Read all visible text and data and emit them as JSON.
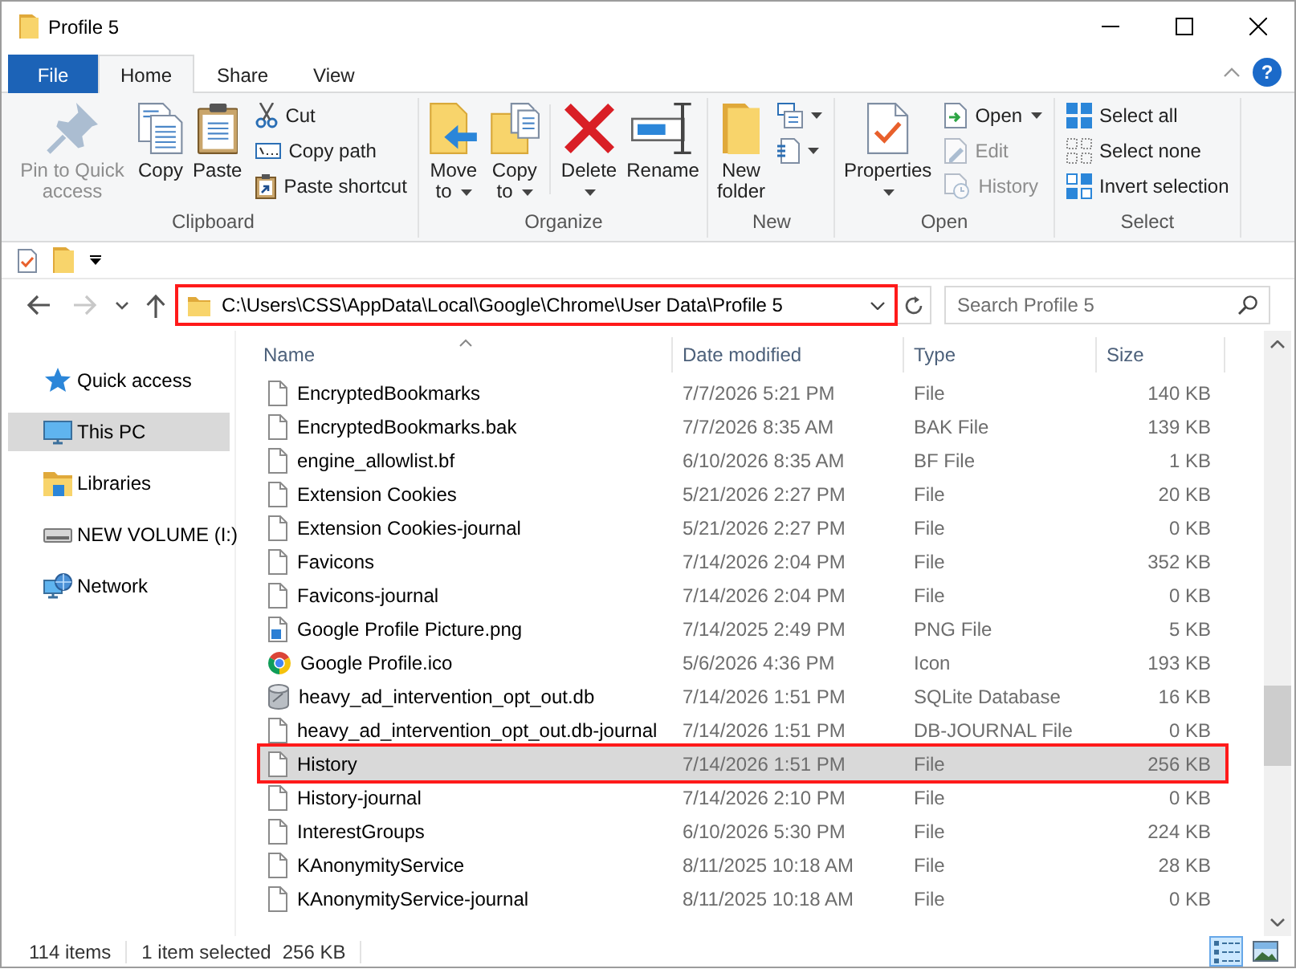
{
  "window": {
    "title": "Profile 5"
  },
  "ribbon_tabs": [
    {
      "label": "File",
      "kind": "file",
      "selected": false
    },
    {
      "label": "Home",
      "kind": "tab",
      "selected": true
    },
    {
      "label": "Share",
      "kind": "tab",
      "selected": false
    },
    {
      "label": "View",
      "kind": "tab",
      "selected": false
    }
  ],
  "help": "?",
  "ribbon": {
    "groups": [
      {
        "label": "Clipboard",
        "commands": [
          {
            "label": "Pin to Quick access",
            "kind": "large",
            "disabled": true,
            "dropdown": false
          },
          {
            "label": "Copy",
            "kind": "large",
            "disabled": false,
            "dropdown": false
          },
          {
            "label": "Paste",
            "kind": "large",
            "disabled": false,
            "dropdown": false
          },
          {
            "label": "Cut",
            "kind": "small",
            "disabled": false,
            "dropdown": false
          },
          {
            "label": "Copy path",
            "kind": "small",
            "disabled": false,
            "dropdown": false
          },
          {
            "label": "Paste shortcut",
            "kind": "small",
            "disabled": false,
            "dropdown": false
          }
        ]
      },
      {
        "label": "Organize",
        "commands": [
          {
            "label": "Move to",
            "kind": "large",
            "disabled": false,
            "dropdown": true
          },
          {
            "label": "Copy to",
            "kind": "large",
            "disabled": false,
            "dropdown": true
          },
          {
            "label": "Delete",
            "kind": "large",
            "disabled": false,
            "dropdown": true
          },
          {
            "label": "Rename",
            "kind": "large",
            "disabled": false,
            "dropdown": false
          }
        ]
      },
      {
        "label": "New",
        "commands": [
          {
            "label": "New folder",
            "kind": "large",
            "disabled": false,
            "dropdown": false
          },
          {
            "kind": "icon",
            "disabled": false,
            "dropdown": true
          },
          {
            "kind": "icon",
            "disabled": false,
            "dropdown": true
          }
        ]
      },
      {
        "label": "Open",
        "commands": [
          {
            "label": "Properties",
            "kind": "large",
            "disabled": false,
            "dropdown": true
          },
          {
            "label": "Open",
            "kind": "small",
            "disabled": false,
            "dropdown": true
          },
          {
            "label": "Edit",
            "kind": "small",
            "disabled": true,
            "dropdown": false
          },
          {
            "label": "History",
            "kind": "small",
            "disabled": true,
            "dropdown": false
          }
        ]
      },
      {
        "label": "Select",
        "commands": [
          {
            "label": "Select all",
            "kind": "small",
            "disabled": false,
            "dropdown": false
          },
          {
            "label": "Select none",
            "kind": "small",
            "disabled": false,
            "dropdown": false
          },
          {
            "label": "Invert selection",
            "kind": "small",
            "disabled": false,
            "dropdown": false
          }
        ]
      }
    ]
  },
  "navigation": [
    {
      "kind": "back",
      "disabled": false
    },
    {
      "kind": "forward",
      "disabled": true
    },
    {
      "kind": "recent",
      "disabled": false
    },
    {
      "kind": "up",
      "disabled": false
    }
  ],
  "address": {
    "path": "C:\\Users\\CSS\\AppData\\Local\\Google\\Chrome\\User Data\\Profile 5",
    "highlighted": true
  },
  "search": {
    "placeholder": "Search Profile 5"
  },
  "nav_pane": {
    "items": [
      {
        "label": "Quick access",
        "selected": false
      },
      {
        "label": "This PC",
        "selected": true
      },
      {
        "label": "Libraries",
        "selected": false
      },
      {
        "label": "NEW VOLUME (I:)",
        "selected": false
      },
      {
        "label": "Network",
        "selected": false
      }
    ]
  },
  "file_list": {
    "columns": [
      {
        "label": "Name",
        "sorted": true
      },
      {
        "label": "Date modified",
        "sorted": false
      },
      {
        "label": "Type",
        "sorted": false
      },
      {
        "label": "Size",
        "sorted": false
      }
    ],
    "rows": [
      {
        "name": "EncryptedBookmarks",
        "date": "7/7/2026 5:21 PM",
        "type": "File",
        "size": "140 KB",
        "kind": "document",
        "selected": false,
        "highlighted": false
      },
      {
        "name": "EncryptedBookmarks.bak",
        "date": "7/7/2026 8:35 AM",
        "type": "BAK File",
        "size": "139 KB",
        "kind": "document",
        "selected": false,
        "highlighted": false
      },
      {
        "name": "engine_allowlist.bf",
        "date": "6/10/2026 8:35 AM",
        "type": "BF File",
        "size": "1 KB",
        "kind": "document",
        "selected": false,
        "highlighted": false
      },
      {
        "name": "Extension Cookies",
        "date": "5/21/2026 2:27 PM",
        "type": "File",
        "size": "20 KB",
        "kind": "document",
        "selected": false,
        "highlighted": false
      },
      {
        "name": "Extension Cookies-journal",
        "date": "5/21/2026 2:27 PM",
        "type": "File",
        "size": "0 KB",
        "kind": "document",
        "selected": false,
        "highlighted": false
      },
      {
        "name": "Favicons",
        "date": "7/14/2026 2:04 PM",
        "type": "File",
        "size": "352 KB",
        "kind": "document",
        "selected": false,
        "highlighted": false
      },
      {
        "name": "Favicons-journal",
        "date": "7/14/2026 2:04 PM",
        "type": "File",
        "size": "0 KB",
        "kind": "document",
        "selected": false,
        "highlighted": false
      },
      {
        "name": "Google Profile Picture.png",
        "date": "7/14/2025 2:49 PM",
        "type": "PNG File",
        "size": "5 KB",
        "kind": "image",
        "selected": false,
        "highlighted": false
      },
      {
        "name": "Google Profile.ico",
        "date": "5/6/2026 4:36 PM",
        "type": "Icon",
        "size": "193 KB",
        "kind": "logo",
        "selected": false,
        "highlighted": false
      },
      {
        "name": "heavy_ad_intervention_opt_out.db",
        "date": "7/14/2026 1:51 PM",
        "type": "SQLite Database",
        "size": "16 KB",
        "kind": "database",
        "selected": false,
        "highlighted": false
      },
      {
        "name": "heavy_ad_intervention_opt_out.db-journal",
        "date": "7/14/2026 1:51 PM",
        "type": "DB-JOURNAL File",
        "size": "0 KB",
        "kind": "document",
        "selected": false,
        "highlighted": false
      },
      {
        "name": "History",
        "date": "7/14/2026 1:51 PM",
        "type": "File",
        "size": "256 KB",
        "kind": "document",
        "selected": true,
        "highlighted": true
      },
      {
        "name": "History-journal",
        "date": "7/14/2026 2:10 PM",
        "type": "File",
        "size": "0 KB",
        "kind": "document",
        "selected": false,
        "highlighted": false
      },
      {
        "name": "InterestGroups",
        "date": "6/10/2026 5:30 PM",
        "type": "File",
        "size": "224 KB",
        "kind": "document",
        "selected": false,
        "highlighted": false
      },
      {
        "name": "KAnonymityService",
        "date": "8/11/2025 10:18 AM",
        "type": "File",
        "size": "28 KB",
        "kind": "document",
        "selected": false,
        "highlighted": false
      },
      {
        "name": "KAnonymityService-journal",
        "date": "8/11/2025 10:18 AM",
        "type": "File",
        "size": "0 KB",
        "kind": "document",
        "selected": false,
        "highlighted": false
      }
    ]
  },
  "status_bar": {
    "item_count": "114 items",
    "selection": "1 item selected",
    "selection_size": "256 KB"
  },
  "views": [
    {
      "kind": "details",
      "selected": true
    },
    {
      "kind": "large_icons",
      "selected": false
    }
  ]
}
